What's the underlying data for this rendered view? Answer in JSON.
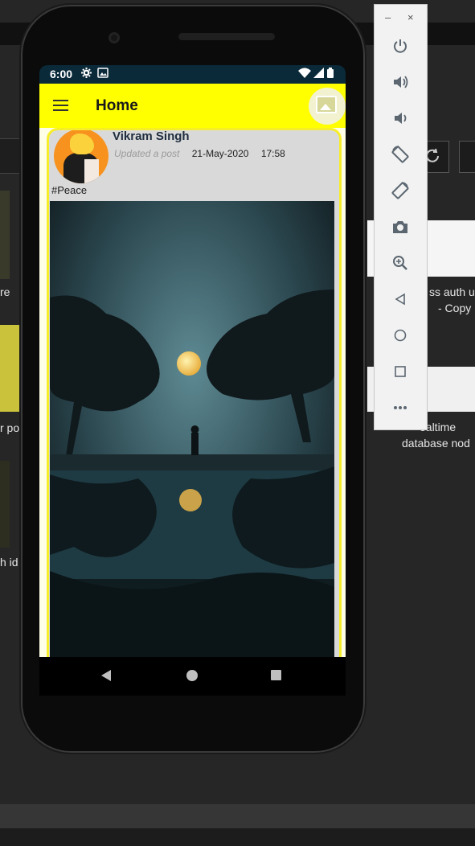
{
  "desktop": {
    "labels": {
      "left1": "re",
      "left2": "r po",
      "left3": "h id",
      "right1_line1": "ss auth us",
      "right1_line2": "- Copy",
      "right2_line1": "ealtime",
      "right2_line2": "database nod"
    }
  },
  "status_bar": {
    "time": "6:00"
  },
  "app_bar": {
    "title": "Home"
  },
  "post": {
    "author": "Vikram Singh",
    "action": "Updated a post",
    "date": "21-May-2020",
    "time": "17:58",
    "caption": "#Peace"
  },
  "emulator_panel": {
    "minimize": "–",
    "close": "×",
    "controls": [
      "power",
      "volume-up",
      "volume-down",
      "rotate-left",
      "rotate-right",
      "camera",
      "zoom",
      "back",
      "home",
      "overview",
      "more"
    ]
  },
  "colors": {
    "app_bar": "#ffff00",
    "status_bar": "#0a2a3a",
    "card_border": "#f7ee2a",
    "card_bg": "#d9d9d9"
  }
}
